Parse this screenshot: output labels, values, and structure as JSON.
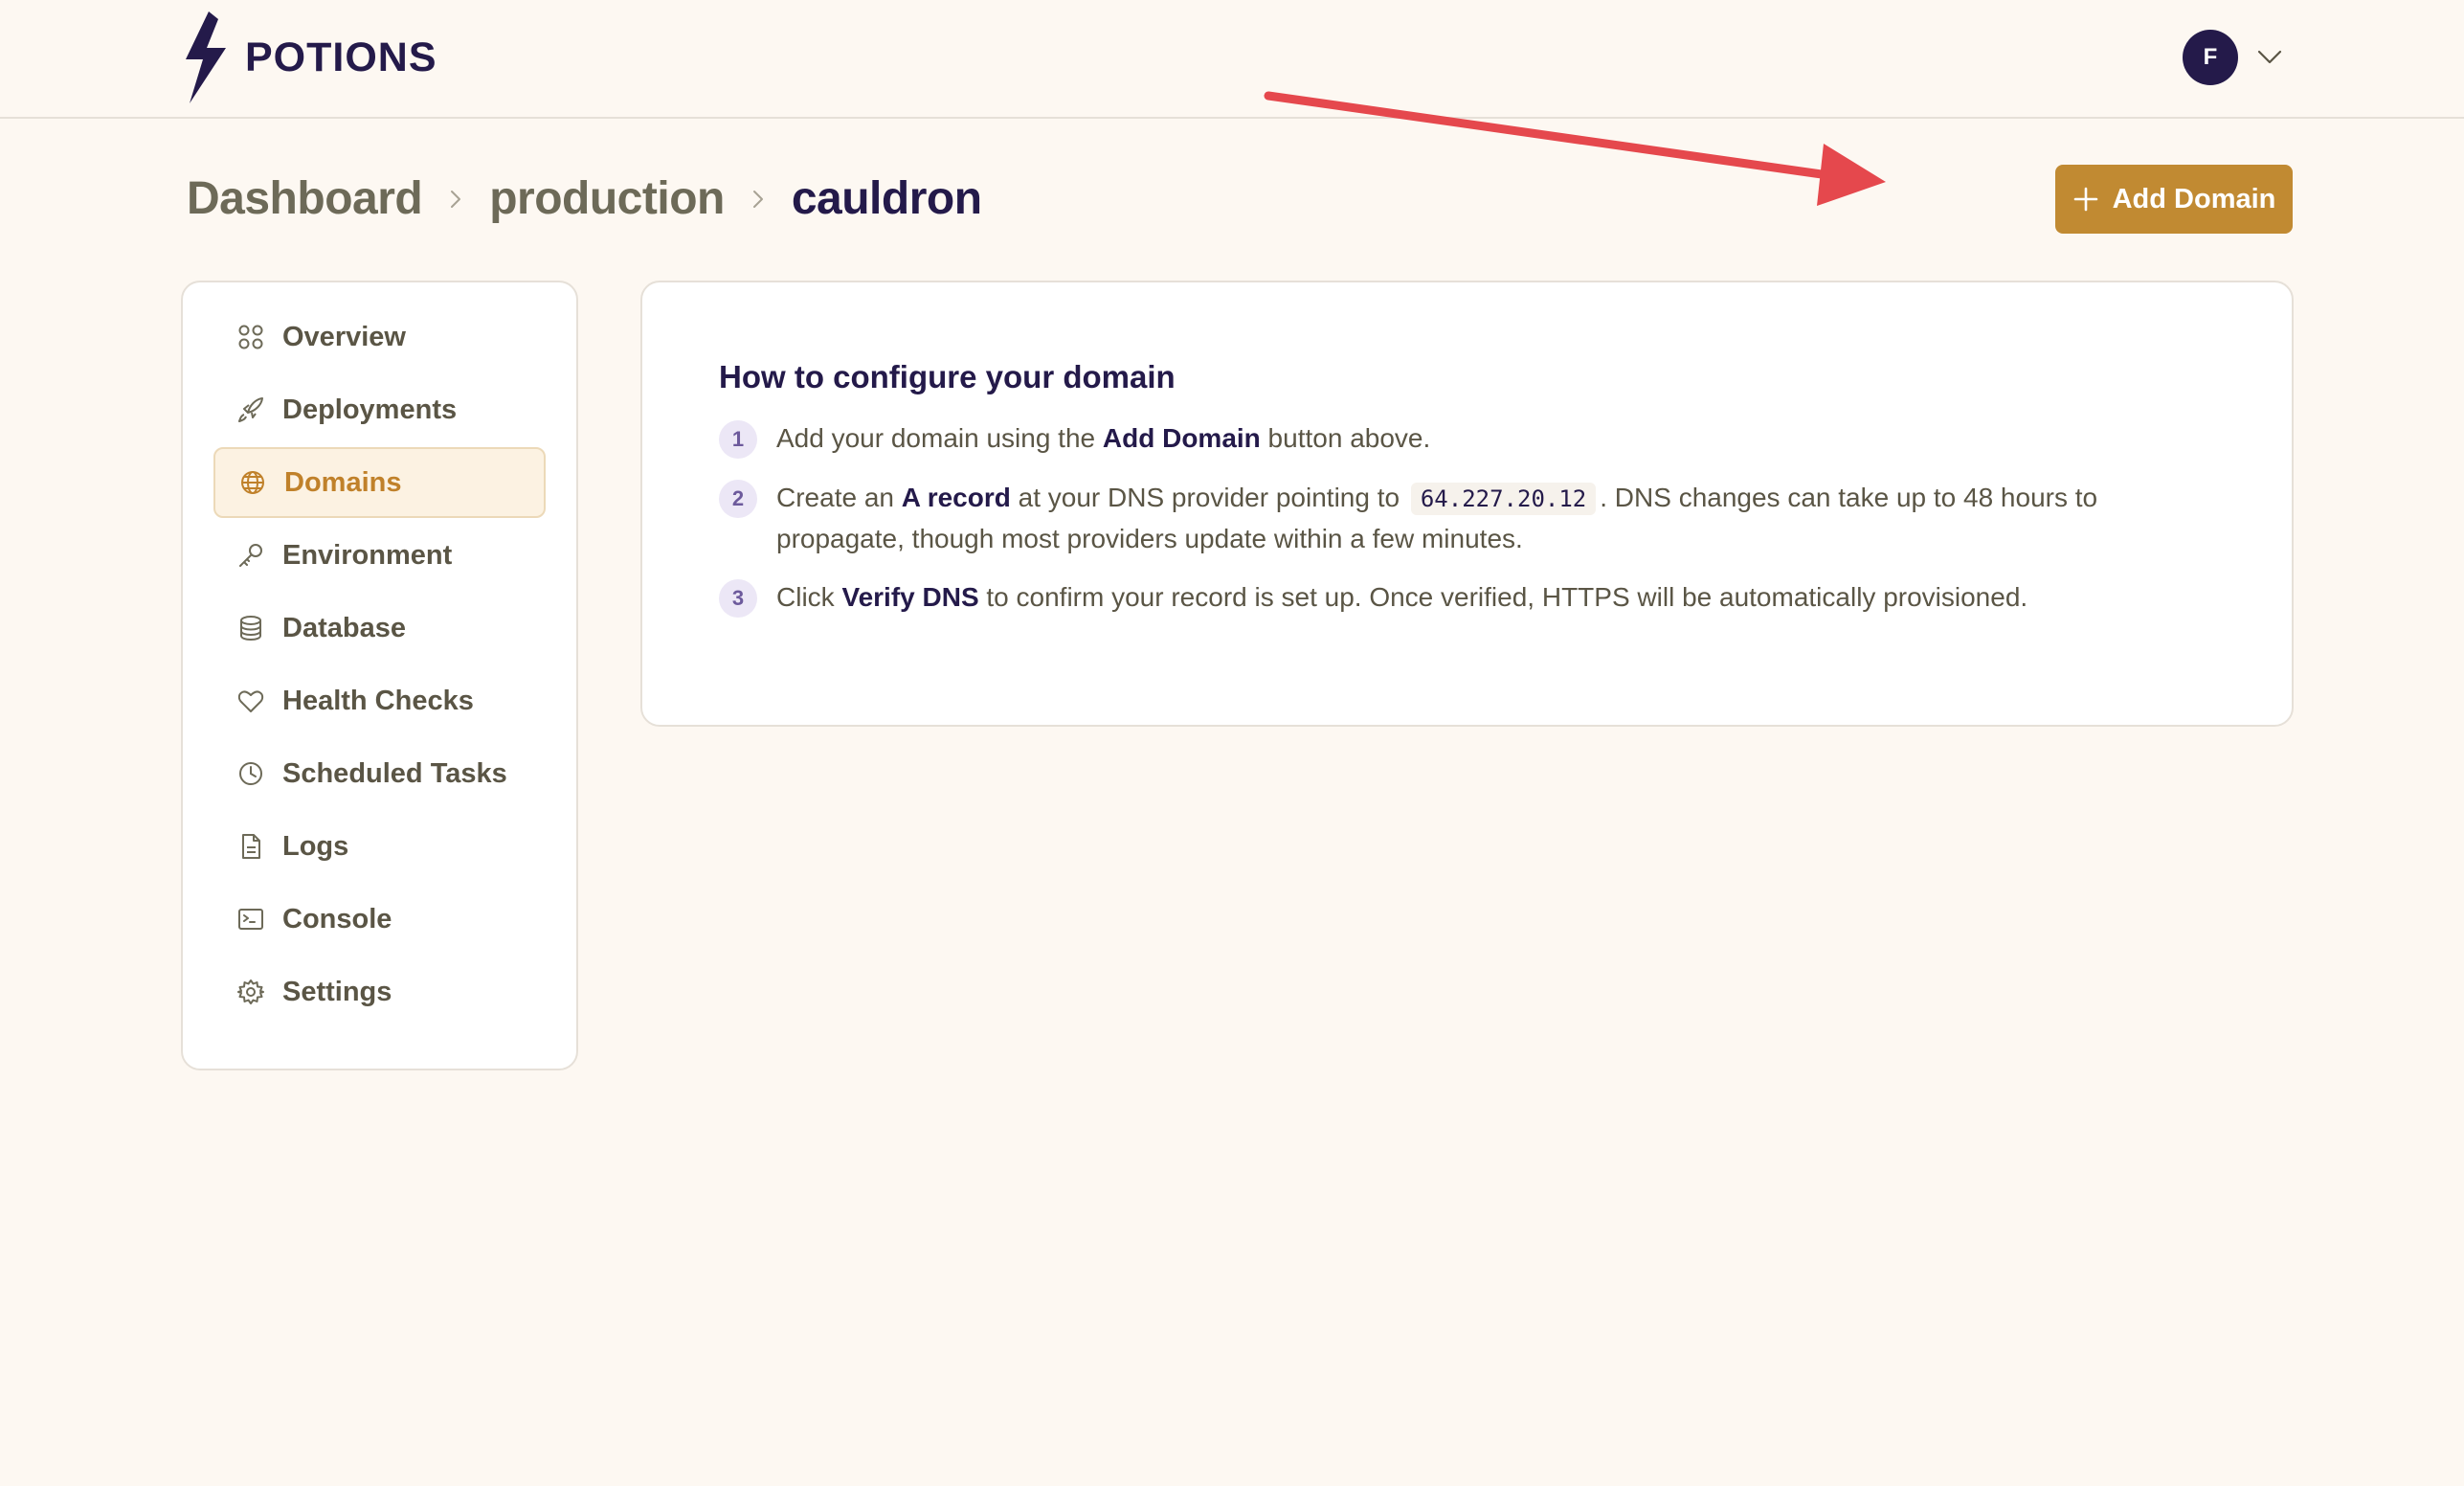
{
  "app": {
    "name": "POTIONS"
  },
  "user": {
    "initial": "F"
  },
  "breadcrumb": [
    {
      "label": "Dashboard"
    },
    {
      "label": "production"
    },
    {
      "label": "cauldron"
    }
  ],
  "actions": {
    "add_domain_label": "Add Domain"
  },
  "sidebar": {
    "items": [
      {
        "label": "Overview",
        "icon": "grid-icon"
      },
      {
        "label": "Deployments",
        "icon": "rocket-icon"
      },
      {
        "label": "Domains",
        "icon": "globe-icon",
        "active": true
      },
      {
        "label": "Environment",
        "icon": "key-icon"
      },
      {
        "label": "Database",
        "icon": "database-icon"
      },
      {
        "label": "Health Checks",
        "icon": "heart-icon"
      },
      {
        "label": "Scheduled Tasks",
        "icon": "clock-icon"
      },
      {
        "label": "Logs",
        "icon": "document-icon"
      },
      {
        "label": "Console",
        "icon": "terminal-icon"
      },
      {
        "label": "Settings",
        "icon": "gear-icon"
      }
    ]
  },
  "instructions": {
    "title": "How to configure your domain",
    "steps": [
      {
        "number": "1",
        "pre": "Add your domain using the ",
        "bold": "Add Domain",
        "post": " button above."
      },
      {
        "number": "2",
        "pre": "Create an ",
        "bold": "A record",
        "mid": " at your DNS provider pointing to ",
        "code": "64.227.20.12",
        "post": ". DNS changes can take up to 48 hours to propagate, though most providers update within a few minutes."
      },
      {
        "number": "3",
        "pre": "Click ",
        "bold": "Verify DNS",
        "post": " to confirm your record is set up. Once verified, HTTPS will be automatically provisioned."
      }
    ]
  },
  "colors": {
    "background": "#fdf8f2",
    "brand": "#241a4a",
    "accent": "#c18a32",
    "annotation_arrow": "#e5484d"
  }
}
